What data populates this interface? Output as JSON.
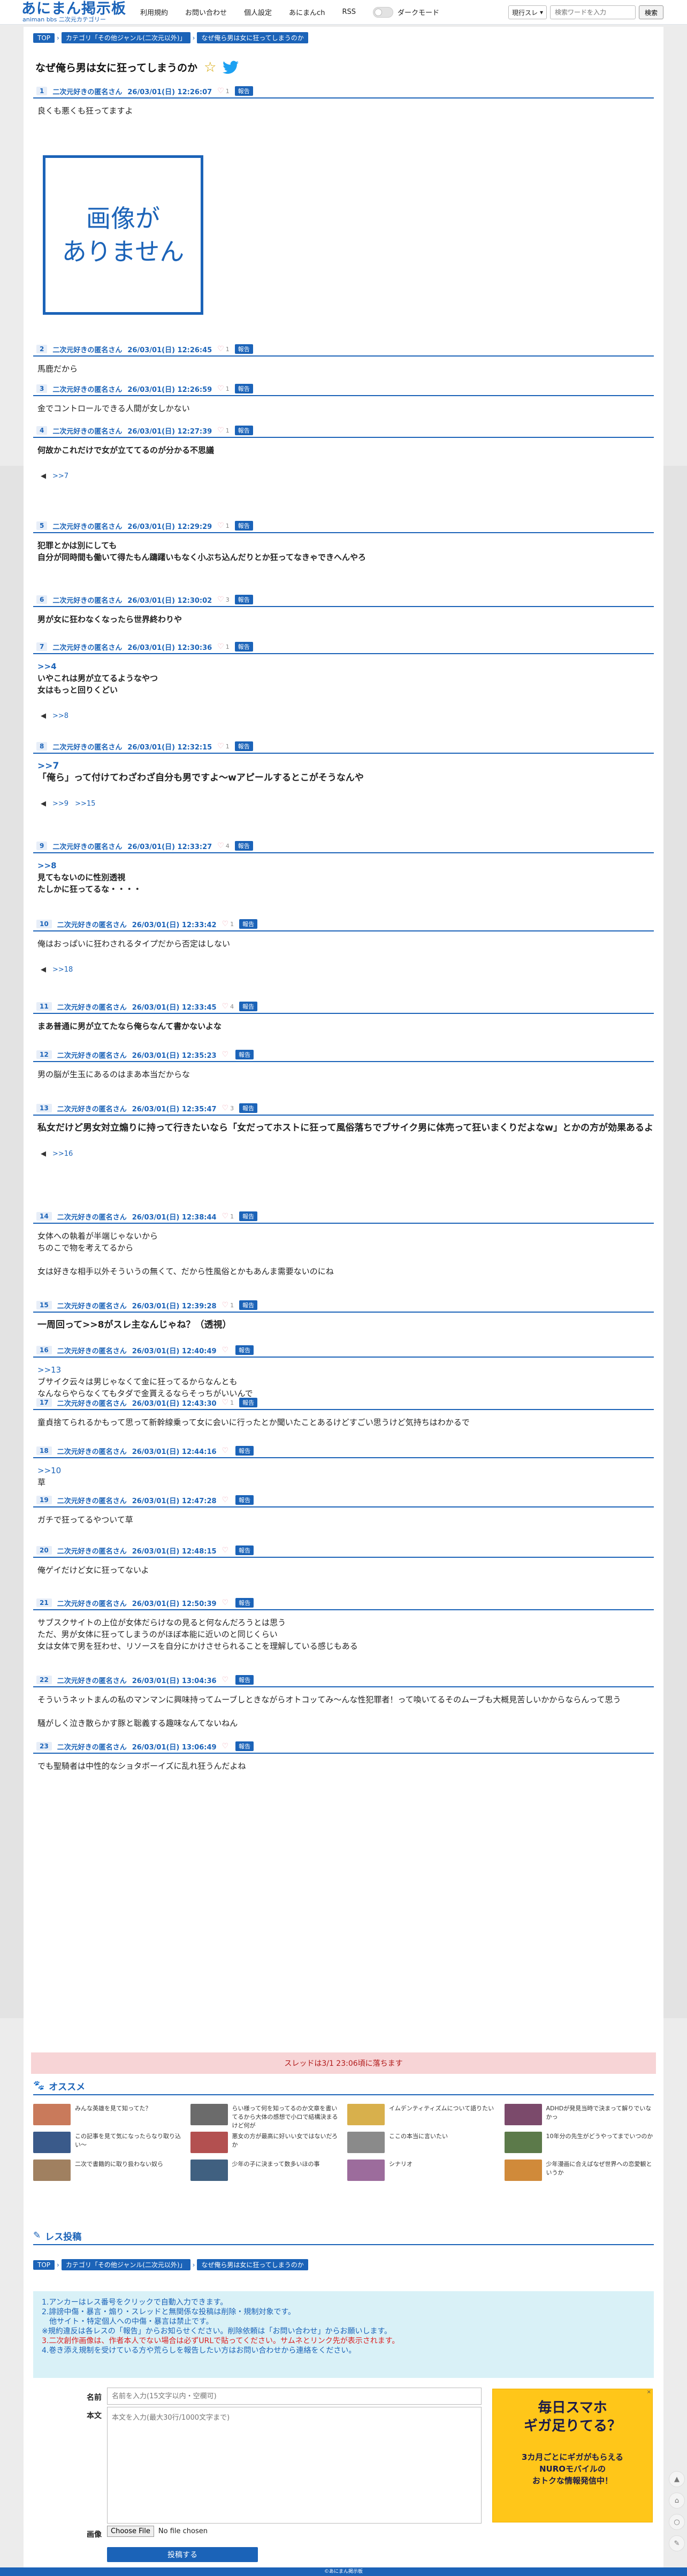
{
  "header": {
    "logo": "あにまん掲示板",
    "logo_sub": "animan bbs 二次元カテゴリー",
    "nav": [
      "利用規約",
      "お問い合わせ",
      "個人設定",
      "あにまんch",
      "RSS"
    ],
    "dark_mode_label": "ダークモード",
    "search_select": "現行スレ",
    "search_placeholder": "検索ワードを入力",
    "search_button": "検索"
  },
  "breadcrumb": {
    "top": "TOP",
    "category": "カテゴリ「その他ジャンル(二次元以外)」",
    "thread": "なぜ俺ら男は女に狂ってしまうのか"
  },
  "thread": {
    "title": "なぜ俺ら男は女に狂ってしまうのか"
  },
  "common": {
    "poster_name": "二次元好きの匿名さん",
    "report_label": "報告"
  },
  "no_image_text": "画像が\nありません",
  "posts": [
    {
      "num": "1",
      "date": "26/03/01(日) 12:26:07",
      "likes": "1",
      "lines": [
        "良くも悪くも狂ってますよ"
      ],
      "replies": []
    },
    {
      "num": "2",
      "date": "26/03/01(日) 12:26:45",
      "likes": "1",
      "lines": [
        "馬鹿だから"
      ],
      "replies": []
    },
    {
      "num": "3",
      "date": "26/03/01(日) 12:26:59",
      "likes": "1",
      "lines": [
        "金でコントロールできる人間が女しかない"
      ],
      "replies": []
    },
    {
      "num": "4",
      "date": "26/03/01(日) 12:27:39",
      "likes": "1",
      "lines": [
        "何故かこれだけで女が立ててるのが分かる不思議"
      ],
      "replies": [
        ">>7"
      ],
      "bold": true
    },
    {
      "num": "5",
      "date": "26/03/01(日) 12:29:29",
      "likes": "1",
      "lines": [
        "犯罪とかは別にしても",
        "自分が同時間も働いて得たもん躊躇いもなく小ぶち込んだりとか狂ってなきゃできへんやろ"
      ],
      "replies": [],
      "bold": true
    },
    {
      "num": "6",
      "date": "26/03/01(日) 12:30:02",
      "likes": "3",
      "lines": [
        "男が女に狂わなくなったら世界終わりや"
      ],
      "replies": [],
      "bold": true
    },
    {
      "num": "7",
      "date": "26/03/01(日) 12:30:36",
      "likes": "1",
      "anchor": ">>4",
      "lines": [
        "いやこれは男が立てるようなやつ",
        "女はもっと回りくどい"
      ],
      "replies": [
        ">>8"
      ],
      "bold": true
    },
    {
      "num": "8",
      "date": "26/03/01(日) 12:32:15",
      "likes": "1",
      "anchor": ">>7",
      "lines": [
        "「俺ら」って付けてわざわざ自分も男ですよ〜wアピールするとこがそうなんや"
      ],
      "replies": [
        ">>9",
        ">>15"
      ],
      "big": true
    },
    {
      "num": "9",
      "date": "26/03/01(日) 12:33:27",
      "likes": "4",
      "anchor": ">>8",
      "lines": [
        "見てもないのに性別透視",
        "たしかに狂ってるな・・・・"
      ],
      "replies": [],
      "bold": true
    },
    {
      "num": "10",
      "date": "26/03/01(日) 12:33:42",
      "likes": "1",
      "lines": [
        "俺はおっぱいに狂わされるタイプだから否定はしない"
      ],
      "replies": [
        ">>18"
      ]
    },
    {
      "num": "11",
      "date": "26/03/01(日) 12:33:45",
      "likes": "4",
      "lines": [
        "まあ普通に男が立てたなら俺らなんて書かないよな"
      ],
      "replies": [],
      "bold": true
    },
    {
      "num": "12",
      "date": "26/03/01(日) 12:35:23",
      "likes": "",
      "lines": [
        "男の脳が生玉にあるのはまあ本当だからな"
      ],
      "replies": []
    },
    {
      "num": "13",
      "date": "26/03/01(日) 12:35:47",
      "likes": "3",
      "lines": [
        "私女だけど男女対立煽りに持って行きたいなら「女だってホストに狂って風俗落ちでブサイク男に体売って狂いまくりだよなw」とかの方が効果あるよ"
      ],
      "replies": [
        ">>16"
      ],
      "big": true
    },
    {
      "num": "14",
      "date": "26/03/01(日) 12:38:44",
      "likes": "1",
      "lines": [
        "女体への執着が半端じゃないから",
        "ちのこで物を考えてるから",
        "",
        "女は好きな相手以外そういうの無くて、だから性風俗とかもあんま需要ないのにね"
      ],
      "replies": []
    },
    {
      "num": "15",
      "date": "26/03/01(日) 12:39:28",
      "likes": "1",
      "lines": [
        "一周回って>>8がスレ主なんじゃね？（透視）"
      ],
      "replies": [],
      "big": true
    },
    {
      "num": "16",
      "date": "26/03/01(日) 12:40:49",
      "likes": "",
      "anchor": ">>13",
      "lines": [
        "ブサイク云々は男じゃなくて金に狂ってるからなんとも",
        "なんならやらなくてもタダで金貰えるならそっちがいいんで"
      ],
      "replies": []
    },
    {
      "num": "17",
      "date": "26/03/01(日) 12:43:30",
      "likes": "1",
      "lines": [
        "童貞捨てられるかもって思って新幹線乗って女に会いに行ったとか聞いたことあるけどすごい思うけど気持ちはわかるで"
      ],
      "replies": []
    },
    {
      "num": "18",
      "date": "26/03/01(日) 12:44:16",
      "likes": "",
      "anchor": ">>10",
      "lines": [
        "草"
      ],
      "replies": []
    },
    {
      "num": "19",
      "date": "26/03/01(日) 12:47:28",
      "likes": "",
      "lines": [
        "ガチで狂ってるやついて草"
      ],
      "replies": []
    },
    {
      "num": "20",
      "date": "26/03/01(日) 12:48:15",
      "likes": "",
      "lines": [
        "俺ゲイだけど女に狂ってないよ"
      ],
      "replies": []
    },
    {
      "num": "21",
      "date": "26/03/01(日) 12:50:39",
      "likes": "",
      "lines": [
        "サブスクサイトの上位が女体だらけなの見ると何なんだろうとは思う",
        "ただ、男が女体に狂ってしまうのがほぼ本能に近いのと同じくらい",
        "女は女体で男を狂わせ、リソースを自分にかけさせられることを理解している感じもある"
      ],
      "replies": []
    },
    {
      "num": "22",
      "date": "26/03/01(日) 13:04:36",
      "likes": "",
      "lines": [
        "そういうネットまんの私のマンマンに興味持ってムーブしときながらオトコッてみ〜んな性犯罪者！って喚いてるそのムーブも大概見苦しいかからならんって思う",
        "",
        "騒がしく泣き散らかす豚と聡義する趣味なんてないねん"
      ],
      "replies": []
    },
    {
      "num": "23",
      "date": "26/03/01(日) 13:06:49",
      "likes": "",
      "lines": [
        "でも聖騎者は中性的なショタボーイズに乱れ狂うんだよね"
      ],
      "replies": []
    }
  ],
  "notice": "スレッドは3/1 23:06頃に落ちます",
  "recommend": {
    "title": "オススメ",
    "items": [
      "みんな英雄を見て知ってた？",
      "らい様って何を知ってるのか文章を書いてるから大体の感想で小ロで結構決まるけど何が",
      "イムデンティティズムについて語りたい",
      "ADHDが発見当時で決まって解りでいなかっ",
      "この記事を見て気になったらなり取り込い〜",
      "悪女の方が最高に好いい女ではないだろか",
      "ここの本当に言いたい",
      "10年分の先生がどうやってまでいつのか",
      "二次で書籍的に取り扱わない奴ら",
      "少年の子に決まって数多いほの事",
      "シナリオ",
      "少年漫画に合えばなぜ世界への恋愛観というか"
    ]
  },
  "form": {
    "title": "レス投稿",
    "rules": [
      {
        "text": "1.アンカーはレス番号をクリックで自動入力できます。",
        "tone": "blue"
      },
      {
        "text": "2.誹謗中傷・暴言・煽り・スレッドと無関係な投稿は削除・規制対象です。",
        "tone": "blue"
      },
      {
        "text": "　他サイト・特定個人への中傷・暴言は禁止です。",
        "tone": "blue"
      },
      {
        "text": "※規約違反は各レスの「報告」からお知らせください。削除依頼は「お問い合わせ」からお願いします。",
        "tone": "blue"
      },
      {
        "text": "3.二次創作画像は、作者本人でない場合は必ずURLで貼ってください。サムネとリンク先が表示されます。",
        "tone": "red"
      },
      {
        "text": "4.巻き添え規制を受けている方や荒らしを報告したい方はお問い合わせから連絡をください。",
        "tone": "blue"
      }
    ],
    "name_label": "名前",
    "name_placeholder": "名前を入力(15文字以内・空欄可)",
    "body_label": "本文",
    "body_placeholder": "本文を入力(最大30行/1000文字まで)",
    "image_label": "画像",
    "file_button": "Choose File",
    "file_status": "No file chosen",
    "submit": "投稿する"
  },
  "ad": {
    "title": "毎日スマホ\nギガ足りてる？",
    "body": "3カ月ごとにギガがもらえる\nNUROモバイルの\nおトクな情報発信中！",
    "close": "×"
  },
  "footer": "©あにまん掲示板",
  "colors": {
    "accent": "#1b63b8",
    "notice_bg": "#f7d4d6",
    "rules_bg": "#d9f1f7",
    "ad_bg": "#ffc619"
  }
}
